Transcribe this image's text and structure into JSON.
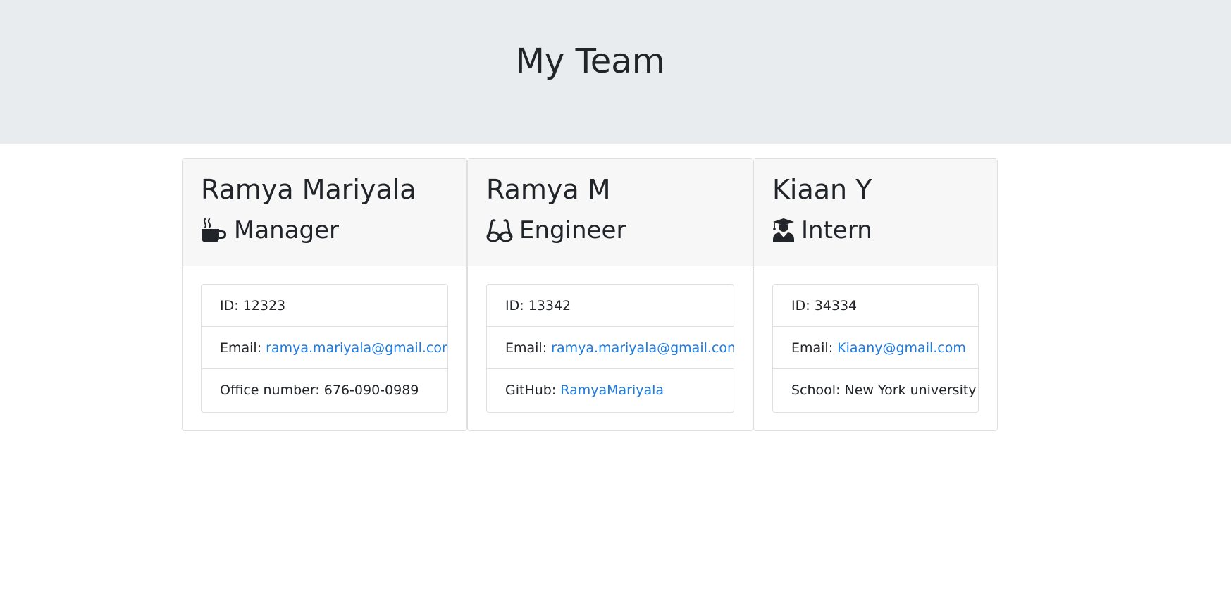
{
  "header": {
    "title": "My Team"
  },
  "cards": [
    {
      "name": "Ramya Mariyala",
      "role": "Manager",
      "role_icon": "coffee-mug-icon",
      "id_label": "ID:",
      "id": "12323",
      "email_label": "Email:",
      "email": "ramya.mariyala@gmail.com",
      "extra_label": "Office number:",
      "extra": "676-090-0989"
    },
    {
      "name": "Ramya M",
      "role": "Engineer",
      "role_icon": "glasses-icon",
      "id_label": "ID:",
      "id": "13342",
      "email_label": "Email:",
      "email": "ramya.mariyala@gmail.com",
      "extra_label": "GitHub:",
      "extra": "RamyaMariyala"
    },
    {
      "name": "Kiaan Y",
      "role": "Intern",
      "role_icon": "graduate-icon",
      "id_label": "ID:",
      "id": "34334",
      "email_label": "Email:",
      "email": "Kiaany@gmail.com",
      "extra_label": "School:",
      "extra": "New York university"
    }
  ],
  "colors": {
    "header_bg": "#e9ecef",
    "card_header_bg": "#f7f7f7",
    "link": "#1e7be0",
    "text": "#212529"
  }
}
